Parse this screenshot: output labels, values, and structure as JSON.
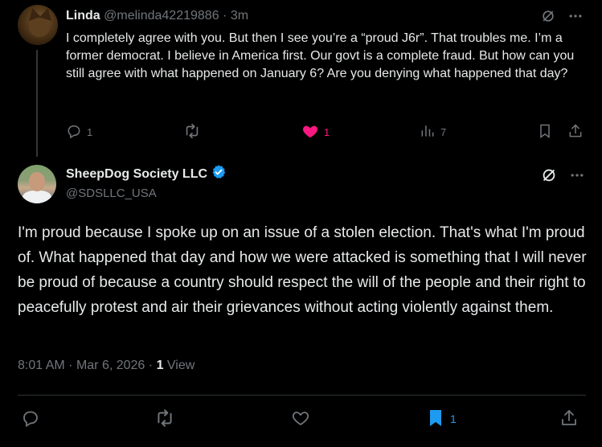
{
  "reply": {
    "author_name": "Linda",
    "author_handle": "@melinda42219886",
    "separator": "·",
    "time_ago": "3m",
    "text": "I completely agree with you. But then I see you’re a “proud J6r”. That troubles me. I’m a former democrat. I believe in America first. Our govt is a complete fraud. But how can you still agree with what happened on January 6? Are you denying what happened that day?",
    "actions": {
      "reply_count": "1",
      "repost_count": "",
      "like_count": "1",
      "views_count": "7"
    },
    "liked": true
  },
  "tweet": {
    "author_name": "SheepDog Society LLC",
    "author_handle": "@SDSLLC_USA",
    "verified": true,
    "text": "I'm proud because I spoke up on an issue of a stolen election. That's what I'm proud of. What happened that day and how we were attacked is something that I will never be proud of because a country should respect the will of the people and their right to peacefully protest and air their grievances without acting violently against them.",
    "time": "8:01 AM",
    "separator": "·",
    "date": "Mar 6, 2026",
    "separator2": "·",
    "views_count": "1",
    "views_label": "View",
    "actions": {
      "reply_count": "",
      "repost_count": "",
      "like_count": "",
      "bookmark_count": "1"
    },
    "bookmarked": true
  },
  "icons": {
    "grok": "grok-icon",
    "more": "more-icon",
    "reply": "reply-icon",
    "repost": "repost-icon",
    "like": "heart-icon",
    "views": "analytics-icon",
    "bookmark": "bookmark-icon",
    "share": "share-icon",
    "verified": "verified-badge-icon"
  },
  "colors": {
    "background": "#000000",
    "text_primary": "#e7e9ea",
    "text_muted": "#71767b",
    "accent_blue": "#1d9bf0",
    "like_pink": "#f91880",
    "divider": "#2f3336"
  }
}
